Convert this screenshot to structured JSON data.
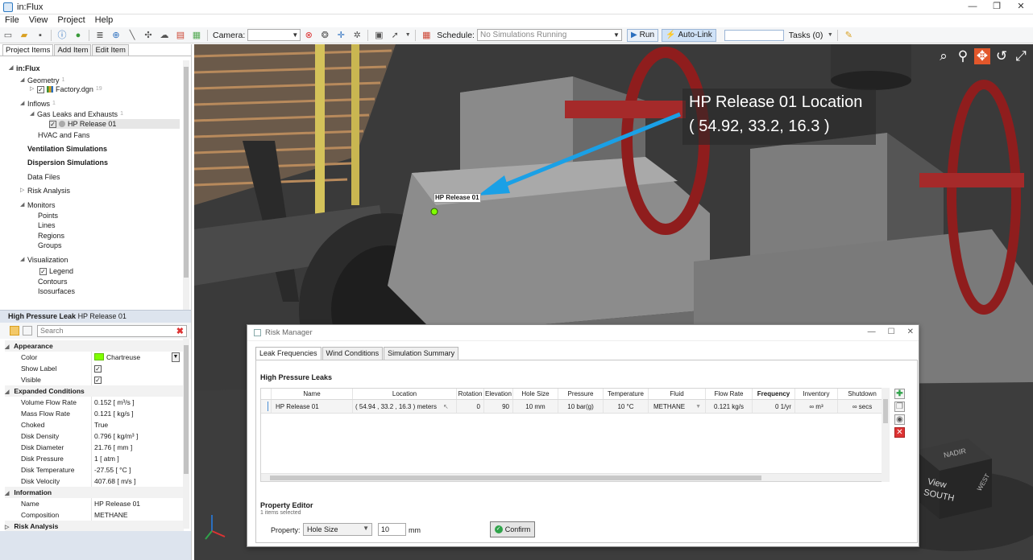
{
  "window": {
    "title": "in:Flux",
    "min": "—",
    "max": "❐",
    "close": "✕"
  },
  "menu": [
    "File",
    "View",
    "Project",
    "Help"
  ],
  "toolbar": {
    "camera_label": "Camera:",
    "schedule_label": "Schedule:",
    "schedule_value": "No Simulations Running",
    "run_label": "Run",
    "autolink_label": "Auto-Link",
    "tasks_label": "Tasks (0)"
  },
  "left_tabs": [
    "Project Items",
    "Add Item",
    "Edit Item"
  ],
  "tree": {
    "root": "in:Flux",
    "geometry": "Geometry",
    "geometry_count": "1",
    "factory": "Factory.dgn",
    "factory_count": "19",
    "inflows": "Inflows",
    "inflows_count": "1",
    "gas_leaks": "Gas Leaks and Exhausts",
    "gas_leaks_count": "1",
    "hp_release": "HP Release 01",
    "hvac": "HVAC and Fans",
    "ventilation": "Ventilation Simulations",
    "dispersion": "Dispersion Simulations",
    "data_files": "Data Files",
    "risk_analysis": "Risk Analysis",
    "monitors": "Monitors",
    "points": "Points",
    "lines": "Lines",
    "regions": "Regions",
    "groups": "Groups",
    "visualization": "Visualization",
    "legend": "Legend",
    "contours": "Contours",
    "isosurfaces": "Isosurfaces"
  },
  "properties": {
    "header_type": "High Pressure Leak",
    "header_name": "HP Release 01",
    "search_placeholder": "Search",
    "appearance": "Appearance",
    "color_label": "Color",
    "color_value": "Chartreuse",
    "show_label": "Show Label",
    "visible": "Visible",
    "expanded": "Expanded Conditions",
    "volume_flow_label": "Volume Flow Rate",
    "volume_flow_value": "0.152 [ m³/s ]",
    "mass_flow_label": "Mass Flow Rate",
    "mass_flow_value": "0.121 [ kg/s ]",
    "choked_label": "Choked",
    "choked_value": "True",
    "disk_density_label": "Disk Density",
    "disk_density_value": "0.796 [ kg/m³ ]",
    "disk_diameter_label": "Disk Diameter",
    "disk_diameter_value": "21.76 [ mm ]",
    "disk_pressure_label": "Disk Pressure",
    "disk_pressure_value": "1 [ atm ]",
    "disk_temp_label": "Disk Temperature",
    "disk_temp_value": "-27.55 [ °C ]",
    "disk_velocity_label": "Disk Velocity",
    "disk_velocity_value": "407.68 [ m/s ]",
    "information": "Information",
    "name_label": "Name",
    "name_value": "HP Release 01",
    "composition_label": "Composition",
    "composition_value": "METHANE",
    "risk_analysis": "Risk Analysis"
  },
  "viewport": {
    "annotation_line1": "HP Release 01 Location",
    "annotation_line2": "( 54.92, 33.2, 16.3 )",
    "tag": "HP Release 01",
    "cube_top": "NADIR",
    "cube_view": "View",
    "cube_south": "SOUTH",
    "cube_side": "WEST"
  },
  "risk_manager": {
    "title": "Risk Manager",
    "tabs": [
      "Leak Frequencies",
      "Wind Conditions",
      "Simulation Summary"
    ],
    "section_title": "High Pressure Leaks",
    "columns": [
      "Name",
      "Location",
      "Rotation",
      "Elevation",
      "Hole Size",
      "Pressure",
      "Temperature",
      "Fluid",
      "Flow Rate",
      "Frequency",
      "Inventory",
      "Shutdown"
    ],
    "row": {
      "name": "HP Release 01",
      "location": "( 54.94 , 33.2 , 16.3 )  meters",
      "rotation": "0",
      "elevation": "90",
      "hole_size": "10  mm",
      "pressure": "10  bar(g)",
      "temperature": "10  °C",
      "fluid": "METHANE",
      "flow_rate": "0.121  kg/s",
      "frequency": "0  1/yr",
      "inventory": "∞  m³",
      "shutdown": "∞  secs"
    },
    "property_editor": "Property Editor",
    "items_selected": "1 items selected",
    "property_label": "Property:",
    "property_value": "Hole Size",
    "value": "10",
    "unit": "mm",
    "confirm": "Confirm"
  }
}
